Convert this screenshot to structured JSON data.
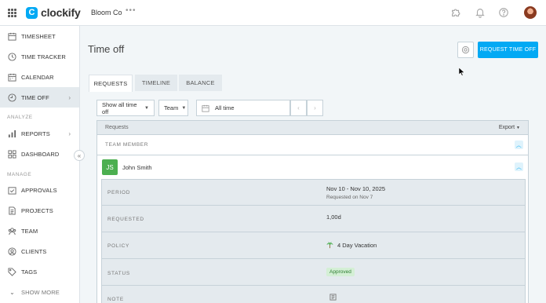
{
  "brand": {
    "name": "clockify",
    "workspace": "Bloom Co"
  },
  "sidebar": {
    "items": [
      {
        "label": "TIMESHEET"
      },
      {
        "label": "TIME TRACKER"
      },
      {
        "label": "CALENDAR"
      },
      {
        "label": "TIME OFF"
      },
      {
        "label": "REPORTS"
      },
      {
        "label": "DASHBOARD"
      },
      {
        "label": "APPROVALS"
      },
      {
        "label": "PROJECTS"
      },
      {
        "label": "TEAM"
      },
      {
        "label": "CLIENTS"
      },
      {
        "label": "TAGS"
      },
      {
        "label": "SHOW MORE"
      }
    ],
    "sections": {
      "analyze": "ANALYZE",
      "manage": "MANAGE"
    }
  },
  "page": {
    "title": "Time off",
    "request_button": "REQUEST TIME OFF",
    "tabs": [
      {
        "label": "REQUESTS",
        "active": true
      },
      {
        "label": "TIMELINE",
        "active": false
      },
      {
        "label": "BALANCE",
        "active": false
      }
    ],
    "filters": {
      "status": "Show all time off",
      "group": "Team",
      "date_range": "All time"
    }
  },
  "table": {
    "title": "Requests",
    "export": "Export",
    "member_header": "TEAM MEMBER",
    "member": {
      "initials": "JS",
      "name": "John Smith"
    },
    "details": {
      "period_label": "PERIOD",
      "period_value": "Nov 10 - Nov 10, 2025",
      "requested_on": "Requested on Nov 7",
      "requested_label": "REQUESTED",
      "requested_value": "1,00d",
      "policy_label": "POLICY",
      "policy_value": "4 Day Vacation",
      "status_label": "STATUS",
      "status_value": "Approved",
      "note_label": "NOTE"
    }
  },
  "colors": {
    "accent": "#03a9f4",
    "avatar_green": "#4caf50",
    "approved_bg": "#d4efd5",
    "approved_text": "#2e7d32"
  }
}
